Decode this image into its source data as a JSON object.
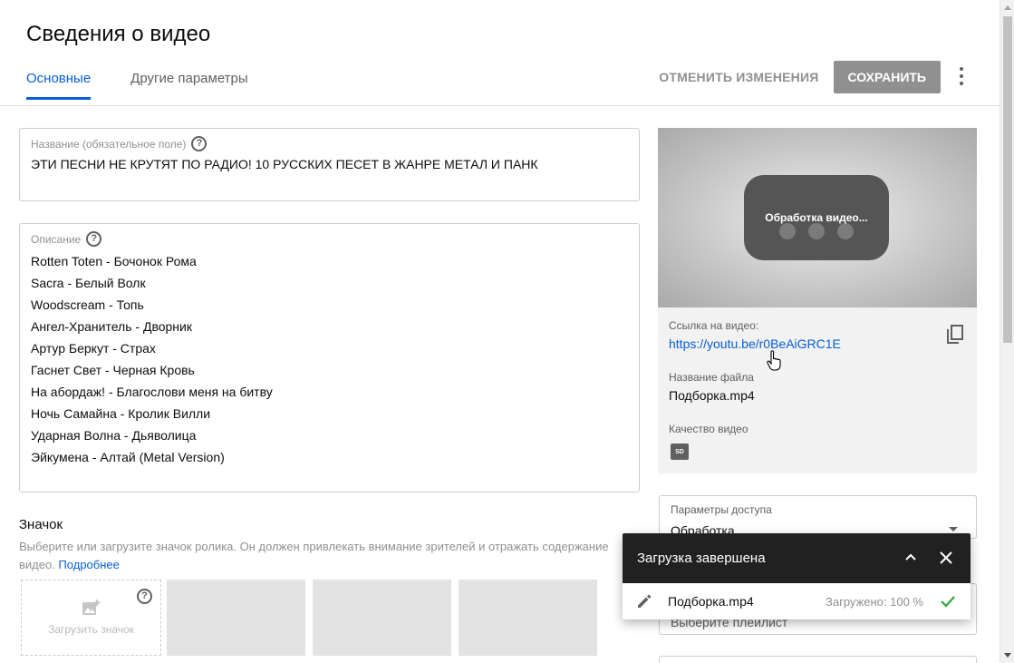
{
  "header": {
    "title": "Сведения о видео",
    "tabs": [
      {
        "label": "Основные",
        "active": true
      },
      {
        "label": "Другие параметры",
        "active": false
      }
    ],
    "discard_label": "ОТМЕНИТЬ ИЗМЕНЕНИЯ",
    "save_label": "СОХРАНИТЬ"
  },
  "title_field": {
    "label": "Название (обязательное поле)",
    "value": "ЭТИ ПЕСНИ НЕ КРУТЯТ ПО РАДИО! 10 РУССКИХ ПЕСЕТ В ЖАНРЕ МЕТАЛ И ПАНК"
  },
  "description_field": {
    "label": "Описание",
    "lines": [
      "Rotten Toten - Бочонок Рома",
      "Sacra - Белый Волк",
      "Woodscream - Топь",
      "Ангел-Хранитель - Дворник",
      "Артур Беркут - Страх",
      "Гаснет Свет - Черная Кровь",
      "На абордаж! - Благослови меня на битву",
      "Ночь Самайна - Кролик Вилли",
      "Ударная Волна - Дьяволица",
      "Эйкумена - Алтай (Metal Version)"
    ]
  },
  "thumbnail": {
    "heading": "Значок",
    "text": "Выберите или загрузите значок ролика. Он должен привлекать внимание зрителей и отражать содержание видео.",
    "more_link": "Подробнее",
    "upload_label": "Загрузить значок"
  },
  "preview": {
    "processing_text": "Обработка видео...",
    "link_label": "Ссылка на видео:",
    "link_value": "https://youtu.be/r0BeAiGRC1E",
    "filename_label": "Название файла",
    "filename_value": "Подборка.mp4",
    "quality_label": "Качество видео",
    "quality_badge": "SD"
  },
  "access": {
    "label": "Параметры доступа",
    "value": "Обработка"
  },
  "playlist": {
    "placeholder": "Выберите плейлист"
  },
  "toast": {
    "title": "Загрузка завершена",
    "file": "Подборка.mp4",
    "status": "Загружено: 100 %"
  },
  "colors": {
    "accent": "#065fd4",
    "save_bg": "#909090",
    "toast_header": "#212121",
    "success": "#2ba640"
  }
}
